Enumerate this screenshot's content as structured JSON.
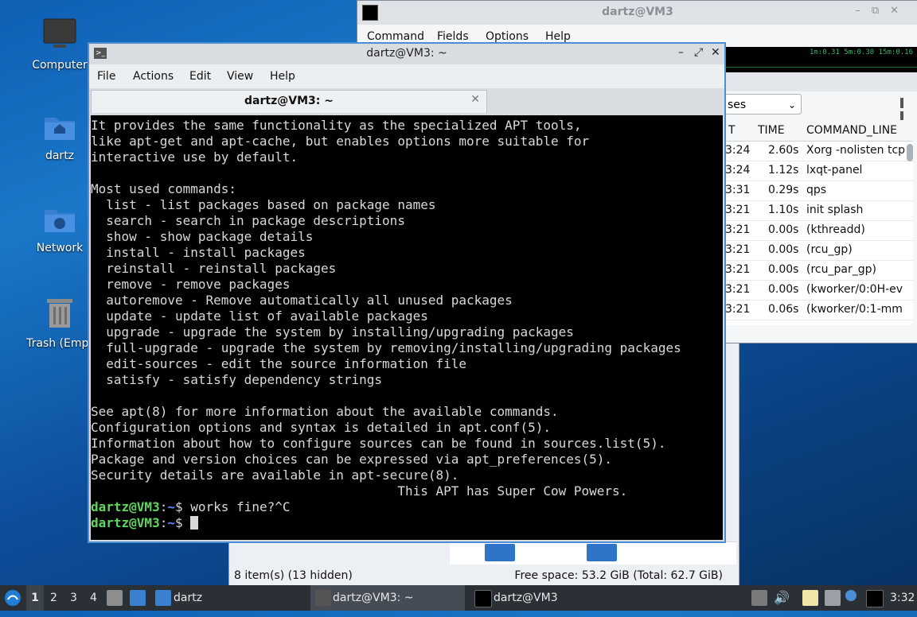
{
  "desktop": {
    "icons": [
      {
        "label": "Computer"
      },
      {
        "label": "dartz"
      },
      {
        "label": "Network"
      },
      {
        "label": "Trash (Empt"
      }
    ]
  },
  "qps": {
    "title": "dartz@VM3",
    "menu": [
      "Command",
      "Fields",
      "Options",
      "Help"
    ],
    "load": "1m:0.31 5m:0.30 15m:0.16",
    "filter_value": "ses",
    "columns": [
      "T",
      "TIME",
      "COMMAND_LINE"
    ],
    "rows": [
      {
        "start": "3:24",
        "time": "2.60s",
        "cmd": "Xorg -nolisten tcp"
      },
      {
        "start": "3:24",
        "time": "1.12s",
        "cmd": "lxqt-panel"
      },
      {
        "start": "3:31",
        "time": "0.29s",
        "cmd": "qps"
      },
      {
        "start": "3:21",
        "time": "1.10s",
        "cmd": "init splash"
      },
      {
        "start": "3:21",
        "time": "0.00s",
        "cmd": "(kthreadd)"
      },
      {
        "start": "3:21",
        "time": "0.00s",
        "cmd": "(rcu_gp)"
      },
      {
        "start": "3:21",
        "time": "0.00s",
        "cmd": "(rcu_par_gp)"
      },
      {
        "start": "3:21",
        "time": "0.00s",
        "cmd": "(kworker/0:0H-ev"
      },
      {
        "start": "3:21",
        "time": "0.06s",
        "cmd": "(kworker/0:1-mm"
      }
    ]
  },
  "filemanager": {
    "status_left": "8 item(s) (13 hidden)",
    "status_right": "Free space: 53.2 GiB (Total: 62.7 GiB)"
  },
  "terminal": {
    "title": "dartz@VM3: ~",
    "menu": [
      "File",
      "Actions",
      "Edit",
      "View",
      "Help"
    ],
    "tab_label": "dartz@VM3: ~",
    "output": "It provides the same functionality as the specialized APT tools,\nlike apt-get and apt-cache, but enables options more suitable for\ninteractive use by default.\n\nMost used commands:\n  list - list packages based on package names\n  search - search in package descriptions\n  show - show package details\n  install - install packages\n  reinstall - reinstall packages\n  remove - remove packages\n  autoremove - Remove automatically all unused packages\n  update - update list of available packages\n  upgrade - upgrade the system by installing/upgrading packages\n  full-upgrade - upgrade the system by removing/installing/upgrading packages\n  edit-sources - edit the source information file\n  satisfy - satisfy dependency strings\n\nSee apt(8) for more information about the available commands.\nConfiguration options and syntax is detailed in apt.conf(5).\nInformation about how to configure sources can be found in sources.list(5).\nPackage and version choices can be expressed via apt_preferences(5).\nSecurity details are available in apt-secure(8).\n                                        This APT has Super Cow Powers.",
    "prompt_user": "dartz@VM3",
    "prompt_sep": ":",
    "prompt_dir": "~",
    "prompt_sym": "$ ",
    "line1_cmd": "works fine?^C",
    "line2_cmd": ""
  },
  "taskbar": {
    "workspaces": [
      "1",
      "2",
      "3",
      "4"
    ],
    "folder_label": "dartz",
    "task_terminal": "dartz@VM3: ~",
    "task_qps": "dartz@VM3",
    "clock": "3:32"
  }
}
